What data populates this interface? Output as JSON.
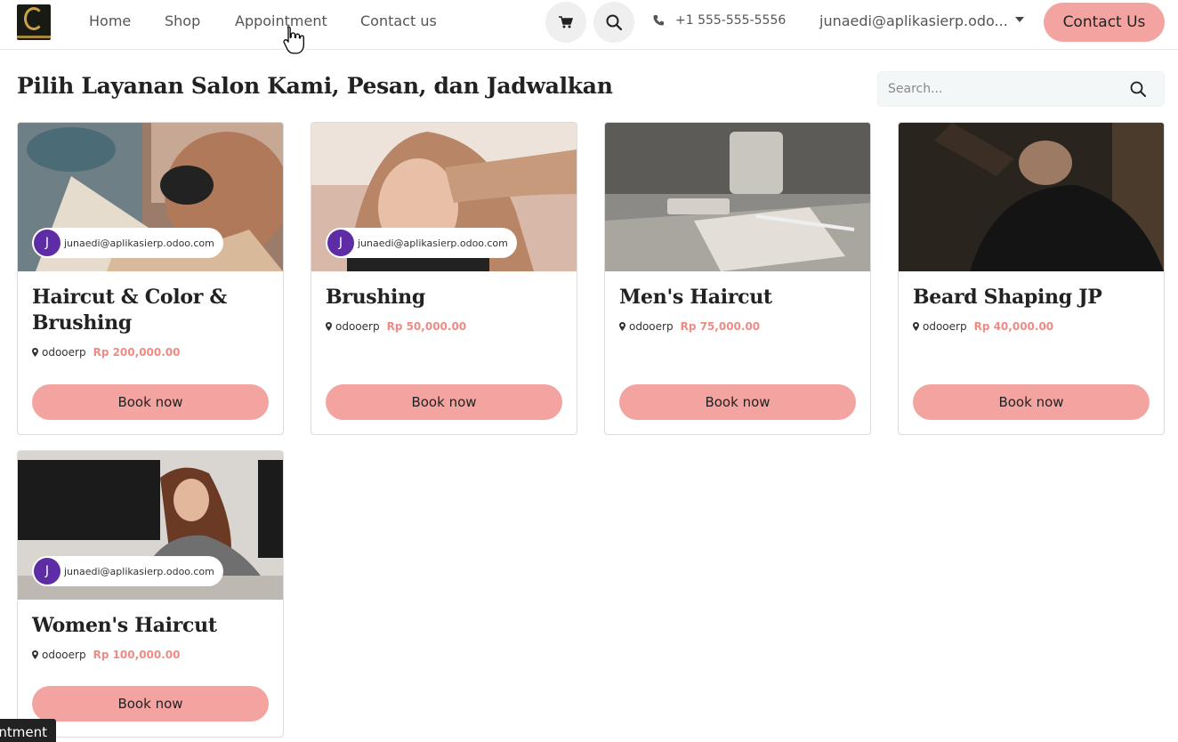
{
  "header": {
    "nav": [
      "Home",
      "Shop",
      "Appointment",
      "Contact us"
    ],
    "phone": "+1 555-555-5556",
    "user": "junaedi@aplikasierp.odo...",
    "contact_button": "Contact Us",
    "icons": {
      "cart": "shopping-cart-icon",
      "search": "search-icon",
      "phone": "phone-icon",
      "dropdown": "caret-down-icon"
    }
  },
  "page": {
    "title": "Pilih Layanan Salon Kami, Pesan, dan Jadwalkan",
    "search_placeholder": "Search..."
  },
  "cards": [
    {
      "name": "Haircut & Color & Brushing",
      "staff": "junaedi@aplikasierp.odoo.com",
      "avatar": "J",
      "location": "odooerp",
      "price": "Rp 200,000.00",
      "button": "Book now",
      "has_staff": true
    },
    {
      "name": "Brushing",
      "staff": "junaedi@aplikasierp.odoo.com",
      "avatar": "J",
      "location": "odooerp",
      "price": "Rp 50,000.00",
      "button": "Book now",
      "has_staff": true
    },
    {
      "name": "Men's Haircut",
      "location": "odooerp",
      "price": "Rp 75,000.00",
      "button": "Book now",
      "has_staff": false
    },
    {
      "name": "Beard Shaping JP",
      "location": "odooerp",
      "price": "Rp 40,000.00",
      "button": "Book now",
      "has_staff": false
    },
    {
      "name": "Women's Haircut",
      "staff": "junaedi@aplikasierp.odoo.com",
      "avatar": "J",
      "location": "odooerp",
      "price": "Rp 100,000.00",
      "button": "Book now",
      "has_staff": true
    }
  ],
  "tooltip": "ntment",
  "colors": {
    "accent": "#f3a4a0",
    "price": "#f08a84",
    "avatar": "#5e2ca5",
    "logo_gold": "#c9a24a"
  }
}
